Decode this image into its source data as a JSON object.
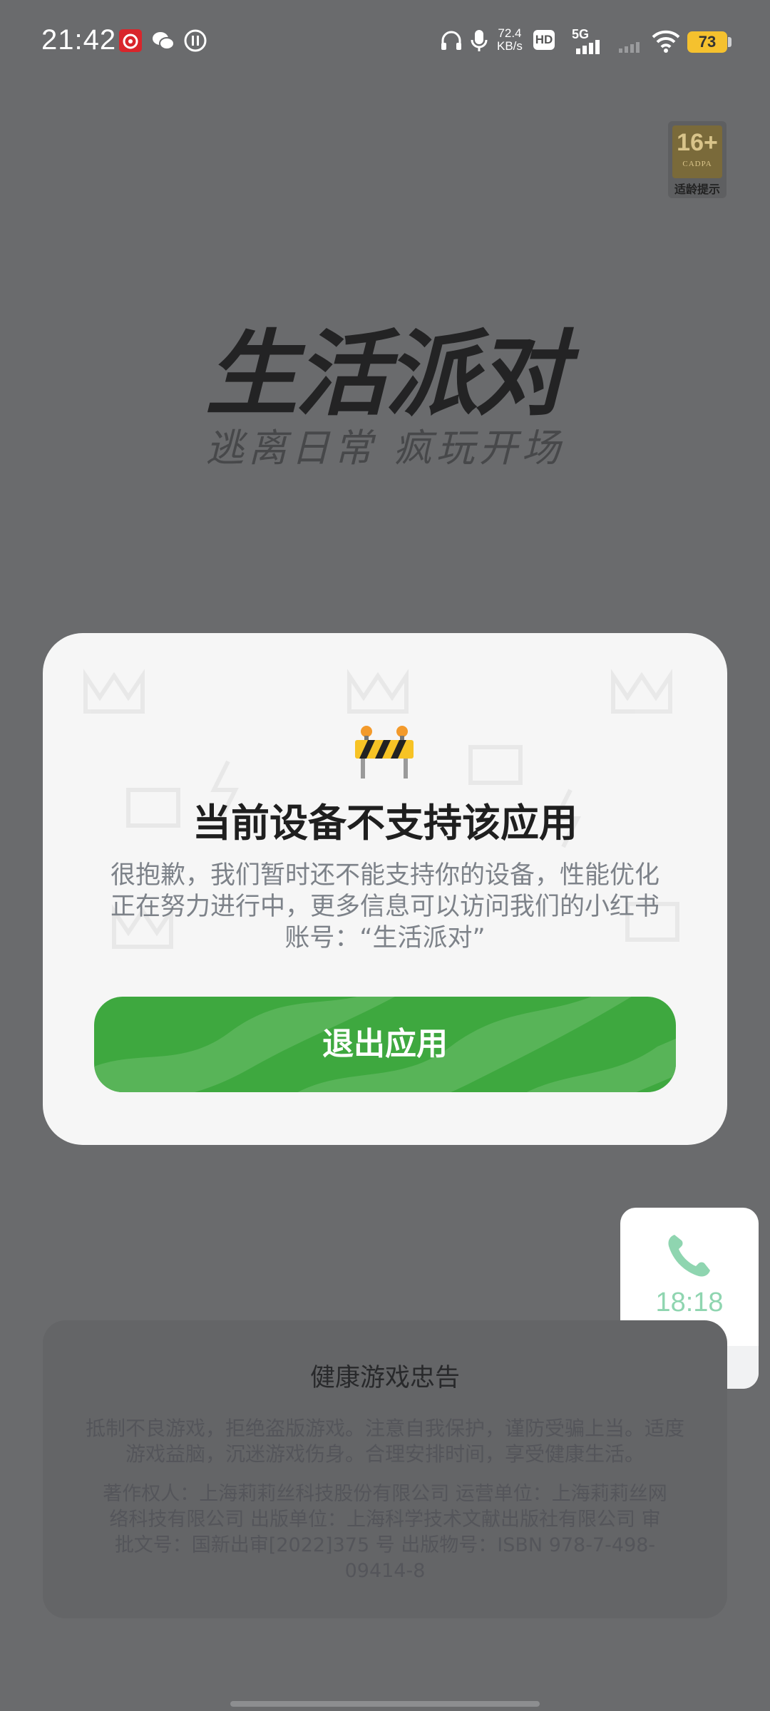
{
  "status_bar": {
    "time": "21:42",
    "net_speed_value": "72.4",
    "net_speed_unit": "KB/s",
    "hd_label": "HD",
    "network_label": "5G",
    "battery_level": "73"
  },
  "age_badge": {
    "rating": "16+",
    "org": "CADPA",
    "caption": "适龄提示"
  },
  "logo": {
    "title": "生活派对",
    "slogan": "逃离日常  疯玩开场"
  },
  "dialog": {
    "title": "当前设备不支持该应用",
    "message": "很抱歉，我们暂时还不能支持你的设备，性能优化正在努力进行中，更多信息可以访问我们的小红书账号：“生活派对”",
    "exit_button_label": "退出应用"
  },
  "call_widget": {
    "timer": "18:18"
  },
  "health_notice": {
    "title": "健康游戏忠告",
    "text": "抵制不良游戏，拒绝盗版游戏。注意自我保护，谨防受骗上当。适度游戏益脑，沉迷游戏伤身。合理安排时间，享受健康生活。",
    "copyright": "著作权人：上海莉莉丝科技股份有限公司 运营单位：上海莉莉丝网络科技有限公司 出版单位：上海科学技术文献出版社有限公司 审批文号：国新出审[2022]375 号 出版物号：ISBN 978-7-498-09414-8"
  },
  "colors": {
    "overlay": "#6a6b6d",
    "dialog_bg": "#f6f6f6",
    "button_green": "#3ea83f",
    "battery_yellow": "#f5c12e",
    "call_green": "#8fd5b0"
  }
}
